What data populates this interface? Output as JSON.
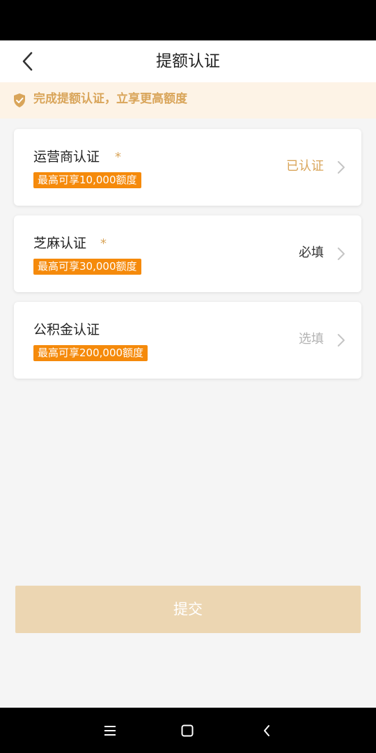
{
  "header": {
    "title": "提额认证"
  },
  "notice": {
    "text": "完成提额认证，立享更高额度"
  },
  "cards": [
    {
      "title": "运营商认证",
      "required_mark": "*",
      "tag": "最高可享10,000额度",
      "status": "已认证",
      "status_color": "#d9a55a"
    },
    {
      "title": "芝麻认证",
      "required_mark": "*",
      "tag": "最高可享30,000额度",
      "status": "必填",
      "status_color": "#333333"
    },
    {
      "title": "公积金认证",
      "required_mark": "",
      "tag": "最高可享200,000额度",
      "status": "选填",
      "status_color": "#b3b3b3"
    }
  ],
  "submit": {
    "label": "提交"
  },
  "colors": {
    "accent": "#d9a55a",
    "tag": "#f58a0b",
    "submit_bg": "#ecd6b2"
  },
  "icons": {
    "back": "chevron-left-icon",
    "notice": "shield-check-icon",
    "chevron": "chevron-right-icon",
    "nav": [
      "menu-icon",
      "home-square-icon",
      "back-triangle-icon"
    ]
  }
}
